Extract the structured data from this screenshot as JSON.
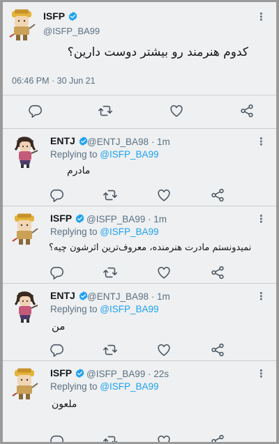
{
  "main_tweet": {
    "name": "ISFP",
    "handle": "@ISFP_BA99",
    "text": "کدوم هنرمند رو بیشتر دوست دارین؟",
    "timestamp": "06:46 PM · 30 Jun 21"
  },
  "replies": [
    {
      "name": "ENTJ",
      "meta": "@ENTJ_BA98 · 1m",
      "replying_prefix": "Replying to ",
      "replying_to": "@ISFP_BA99",
      "text": "مادرم"
    },
    {
      "name": "ISFP",
      "meta": "@ISFP_BA99 · 1m",
      "replying_prefix": "Replying to ",
      "replying_to": "@ISFP_BA99",
      "text": "نمیدونستم مادرت هنرمنده، معروف‌ترین اثرشون چیه؟"
    },
    {
      "name": "ENTJ",
      "meta": "@ENTJ_BA98 · 1m",
      "replying_prefix": "Replying to ",
      "replying_to": "@ISFP_BA99",
      "text": "من"
    },
    {
      "name": "ISFP",
      "meta": "@ISFP_BA99 · 22s",
      "replying_prefix": "Replying to ",
      "replying_to": "@ISFP_BA99",
      "text": "ملعون"
    }
  ],
  "colors": {
    "link": "#1da1f2",
    "muted": "#5b7083",
    "background": "#eef0f1"
  },
  "icons": [
    "reply-icon",
    "retweet-icon",
    "like-icon",
    "share-icon",
    "verified-icon",
    "more-icon"
  ]
}
